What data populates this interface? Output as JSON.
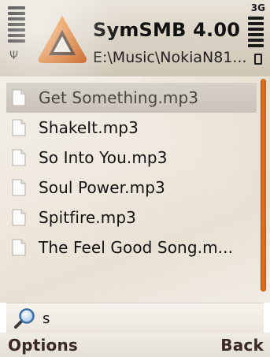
{
  "header": {
    "title": "SymSMB 4.00",
    "path": "E:\\Music\\NokiaN81...",
    "network_indicator": "3G"
  },
  "colors": {
    "accent_orange": "#e2781f",
    "logo_dark_orange": "#c85a10"
  },
  "files": [
    {
      "name": "Get Something.mp3",
      "selected": true
    },
    {
      "name": "ShakeIt.mp3",
      "selected": false
    },
    {
      "name": "So Into You.mp3",
      "selected": false
    },
    {
      "name": "Soul Power.mp3",
      "selected": false
    },
    {
      "name": "Spitfire.mp3",
      "selected": false
    },
    {
      "name": "The Feel Good Song.m...",
      "selected": false
    }
  ],
  "search": {
    "value": "s"
  },
  "softkeys": {
    "left": "Options",
    "right": "Back"
  },
  "icons": {
    "logo": "symsmb-logo-icon",
    "file": "file-icon",
    "search": "search-icon",
    "signal": "signal-strength-icon",
    "battery": "battery-level-icon"
  }
}
